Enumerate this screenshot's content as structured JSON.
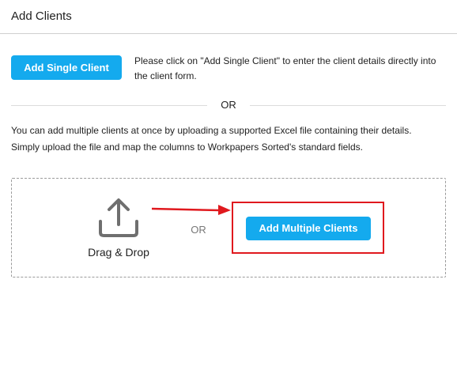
{
  "header": {
    "title": "Add Clients"
  },
  "single": {
    "button_label": "Add Single Client",
    "description": "Please click on \"Add Single Client\" to enter the client details directly into the client form."
  },
  "separator": {
    "or_label": "OR"
  },
  "multiple": {
    "description_line1": "You can add multiple clients at once by uploading a supported Excel file containing their details.",
    "description_line2": "Simply upload the file and map the columns to Workpapers Sorted's standard fields."
  },
  "dropzone": {
    "upload_icon": "upload-icon",
    "drag_drop_label": "Drag & Drop",
    "or_label": "OR",
    "button_label": "Add Multiple Clients"
  },
  "colors": {
    "accent": "#14aaee",
    "annotation": "#e0191e",
    "icon": "#6f6f6f"
  }
}
